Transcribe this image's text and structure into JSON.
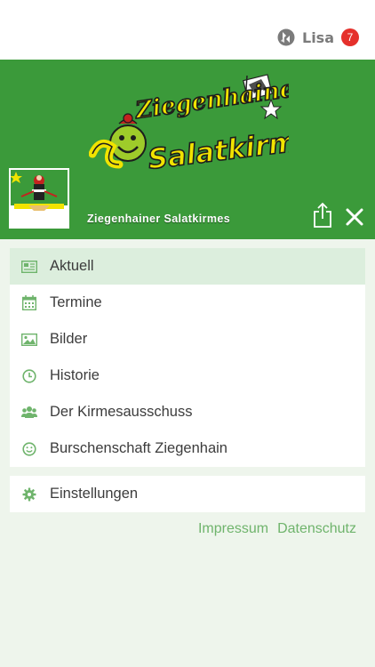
{
  "topbar": {
    "user_name": "Lisa",
    "notification_count": "7"
  },
  "header": {
    "logo_line1": "Ziegenhainer",
    "logo_line2": "Salatkirmes",
    "club_name": "Ziegenhainer Salatkirmes"
  },
  "menu": {
    "items": [
      {
        "label": "Aktuell",
        "icon": "newspaper-icon"
      },
      {
        "label": "Termine",
        "icon": "calendar-icon"
      },
      {
        "label": "Bilder",
        "icon": "image-icon"
      },
      {
        "label": "Historie",
        "icon": "clock-icon"
      },
      {
        "label": "Der Kirmesausschuss",
        "icon": "group-icon"
      },
      {
        "label": "Burschenschaft Ziegenhain",
        "icon": "smiley-icon"
      }
    ],
    "settings_label": "Einstellungen"
  },
  "footer": {
    "impressum": "Impressum",
    "datenschutz": "Datenschutz"
  },
  "colors": {
    "brand_green": "#3b9a3a",
    "active_row": "#dceedd",
    "icon_green": "#6fb46c",
    "badge_red": "#e5302b"
  }
}
